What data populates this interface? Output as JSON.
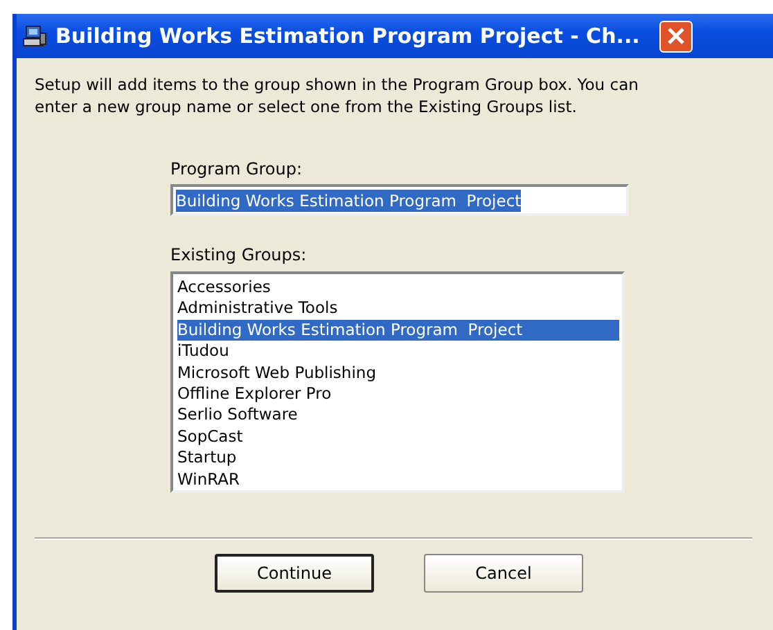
{
  "window": {
    "title": "Building Works Estimation Program Project - Ch..."
  },
  "intro": "Setup will add items to the group shown in the Program Group box. You can enter a new group name or select one from the Existing Groups list.",
  "program_group": {
    "label": "Program Group:",
    "value": "Building Works Estimation Program  Project",
    "value_selected": true
  },
  "existing_groups": {
    "label": "Existing Groups:",
    "items": [
      {
        "label": "Accessories",
        "selected": false
      },
      {
        "label": "Administrative Tools",
        "selected": false
      },
      {
        "label": "Building Works Estimation Program  Project",
        "selected": true
      },
      {
        "label": "iTudou",
        "selected": false
      },
      {
        "label": "Microsoft Web Publishing",
        "selected": false
      },
      {
        "label": "Offline Explorer Pro",
        "selected": false
      },
      {
        "label": "Serlio Software",
        "selected": false
      },
      {
        "label": "SopCast",
        "selected": false
      },
      {
        "label": "Startup",
        "selected": false
      },
      {
        "label": "WinRAR",
        "selected": false
      }
    ]
  },
  "buttons": [
    {
      "label": "Continue",
      "default": true
    },
    {
      "label": "Cancel",
      "default": false
    }
  ]
}
